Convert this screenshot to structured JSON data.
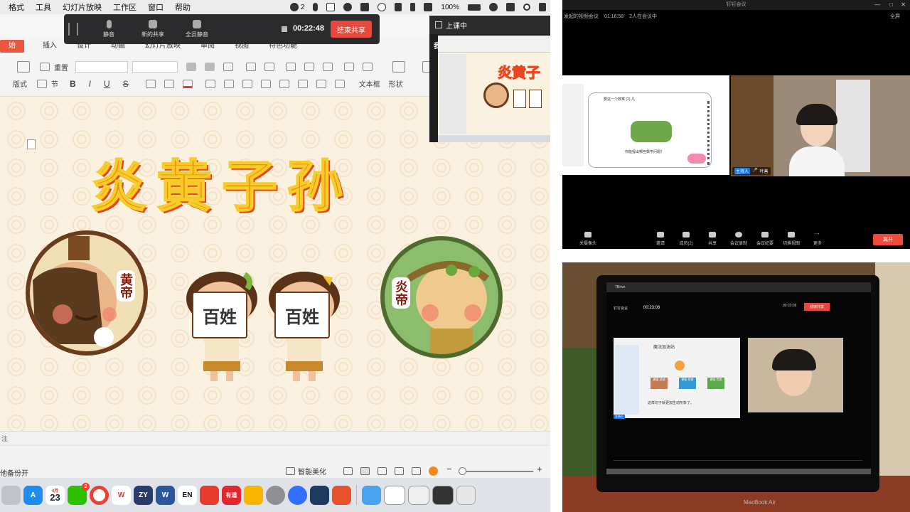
{
  "mac_menubar": {
    "items": [
      "格式",
      "工具",
      "幻灯片放映",
      "工作区",
      "窗口",
      "帮助"
    ],
    "wechat_count": "2",
    "battery": "100%"
  },
  "share_bar": {
    "mute": "静音",
    "new_share": "新的共享",
    "mute_all": "全员静音",
    "timer": "00:22:48",
    "end_share": "结束共享"
  },
  "ribbon": {
    "tabs": [
      "始",
      "插入",
      "设计",
      "动画",
      "幻灯片放映",
      "审阅",
      "视图",
      "特色功能"
    ],
    "reset": "重置",
    "layout": "版式",
    "section": "节",
    "textbox": "文本框",
    "shape": "形状"
  },
  "slide": {
    "title": "炎黄子孙",
    "label_huangdi": "黄帝",
    "label_yandi": "炎帝",
    "sign_1": "百姓",
    "sign_2": "百姓"
  },
  "pip": {
    "header": "上课中",
    "label": "我",
    "slide_title": "炎黄子"
  },
  "status_bar": {
    "note": "注",
    "backup": "他备份开",
    "beautify": "智能美化"
  },
  "dock": {
    "wechat_badge": "2",
    "calendar_month": "4月",
    "calendar_day": "23",
    "apps": [
      "W",
      "ZY",
      "W",
      "EN",
      "有道"
    ]
  },
  "meeting_top": {
    "app_title": "钉钉会议",
    "meeting_name": "发起的视频会议",
    "duration": "01:16:58",
    "participants": "2人在会议中",
    "fullscreen": "全屏",
    "host_tag": "主持人",
    "user_name": "叶善",
    "slide_heading": "要这一个数乘 (2) 几",
    "slide_question": "你能提出哪些数学问题？",
    "toolbar": [
      "关摄像头",
      "邀请",
      "成员(2)",
      "共享",
      "会议录制",
      "会议纪要",
      "切换视图",
      "更多"
    ],
    "leave": "离开"
  },
  "meeting_photo": {
    "tbrive": "TBrive",
    "app_title": "钉钉会议",
    "timer": "00:23:06",
    "end": "结束共享",
    "slide_heading": "魔法加油站",
    "slide_sentence": "这样句子就更加生动形象了。",
    "choices": [
      "做饭 总结",
      "做饭 检查",
      "做饭 完成"
    ],
    "host_tag": "主持人",
    "laptop_brand": "MacBook Air"
  }
}
